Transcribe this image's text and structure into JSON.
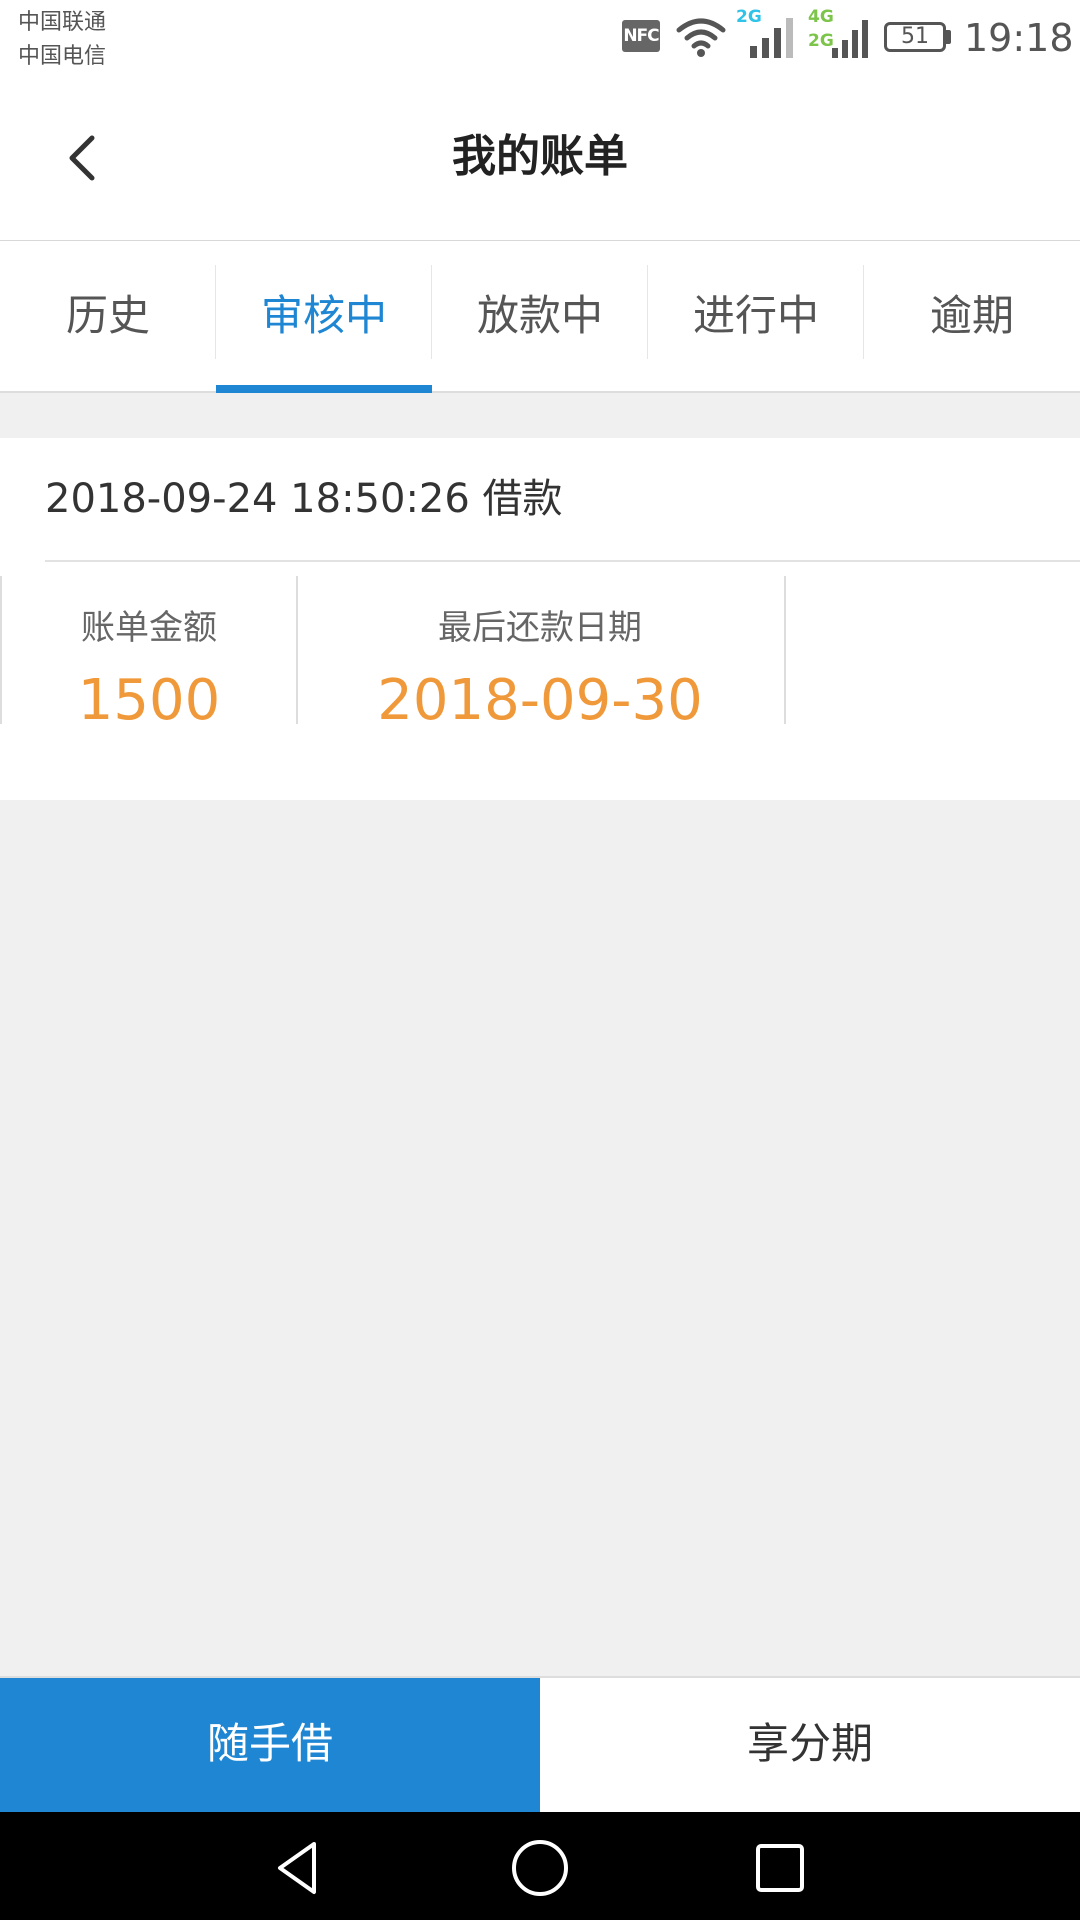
{
  "status_bar": {
    "carrier_1": "中国联通",
    "carrier_2": "中国电信",
    "nfc_label": "NFC",
    "network_1": "2G",
    "network_2_top": "4G",
    "network_2_bottom": "2G",
    "battery": "51",
    "time": "19:18",
    "icons": [
      "nfc-icon",
      "wifi-icon",
      "signal-icon",
      "battery-icon"
    ]
  },
  "header": {
    "title": "我的账单",
    "back_icon": "chevron-left-icon"
  },
  "tabs": [
    {
      "label": "历史",
      "active": false
    },
    {
      "label": "审核中",
      "active": true
    },
    {
      "label": "放款中",
      "active": false
    },
    {
      "label": "进行中",
      "active": false
    },
    {
      "label": "逾期",
      "active": false
    }
  ],
  "bill": {
    "date_title": "2018-09-24 18:50:26 借款",
    "amount_label": "账单金额",
    "amount_value": "1500",
    "due_label": "最后还款日期",
    "due_value": "2018-09-30"
  },
  "bottom_buttons": {
    "borrow": "随手借",
    "installment": "享分期"
  },
  "colors": {
    "accent": "#1e86d2",
    "highlight": "#f0993a",
    "background": "#f0f0f0"
  },
  "nav_bar": {
    "icons": [
      "back-triangle-icon",
      "home-circle-icon",
      "recent-square-icon"
    ]
  }
}
